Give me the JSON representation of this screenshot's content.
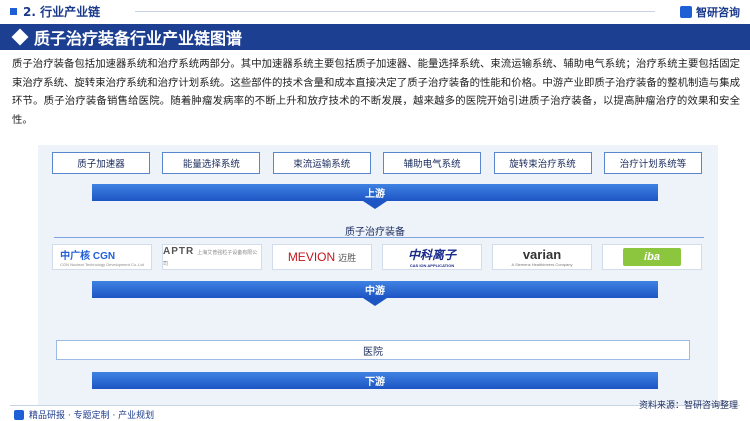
{
  "header": {
    "section": "2. 行业产业链",
    "brand": "智研咨询"
  },
  "title": "质子治疗装备行业产业链图谱",
  "intro": "质子治疗装备包括加速器系统和治疗系统两部分。其中加速器系统主要包括质子加速器、能量选择系统、束流运输系统、辅助电气系统；治疗系统主要包括固定束治疗系统、旋转束治疗系统和治疗计划系统。这些部件的技术含量和成本直接决定了质子治疗装备的性能和价格。中游产业即质子治疗装备的整机制造与集成环节。质子治疗装备销售给医院。随着肿瘤发病率的不断上升和放疗技术的不断发展，越来越多的医院开始引进质子治疗装备，以提高肿瘤治疗的效果和安全性。",
  "upstream": {
    "items": [
      "质子加速器",
      "能量选择系统",
      "束流运输系统",
      "辅助电气系统",
      "旋转束治疗系统",
      "治疗计划系统等"
    ],
    "band_label": "上游"
  },
  "midstream": {
    "title": "质子治疗装备",
    "logos": [
      {
        "name": "中广核 CGN",
        "sub": "CGN Nuclear Technology Development Co.,Ltd"
      },
      {
        "name": "APTR",
        "sub": "上海艾普强粒子设备有限公司"
      },
      {
        "name": "MEVION",
        "sub": "迈胜"
      },
      {
        "name": "中科离子",
        "sub": "CAS ION APPLICATION"
      },
      {
        "name": "varian",
        "sub": "A Siemens Healthineers Company"
      },
      {
        "name": "iba",
        "sub": ""
      }
    ],
    "band_label": "中游"
  },
  "downstream": {
    "hospital": "医院",
    "band_label": "下游"
  },
  "footer": {
    "left": "精品研报 · 专题定制 · 产业规划",
    "source": "资料来源：智研咨询整理"
  },
  "colors": {
    "title_bar": "#1d3f91",
    "band": "#1d55c4",
    "node_border": "#5a86cf",
    "panel": "#eef3fa"
  }
}
